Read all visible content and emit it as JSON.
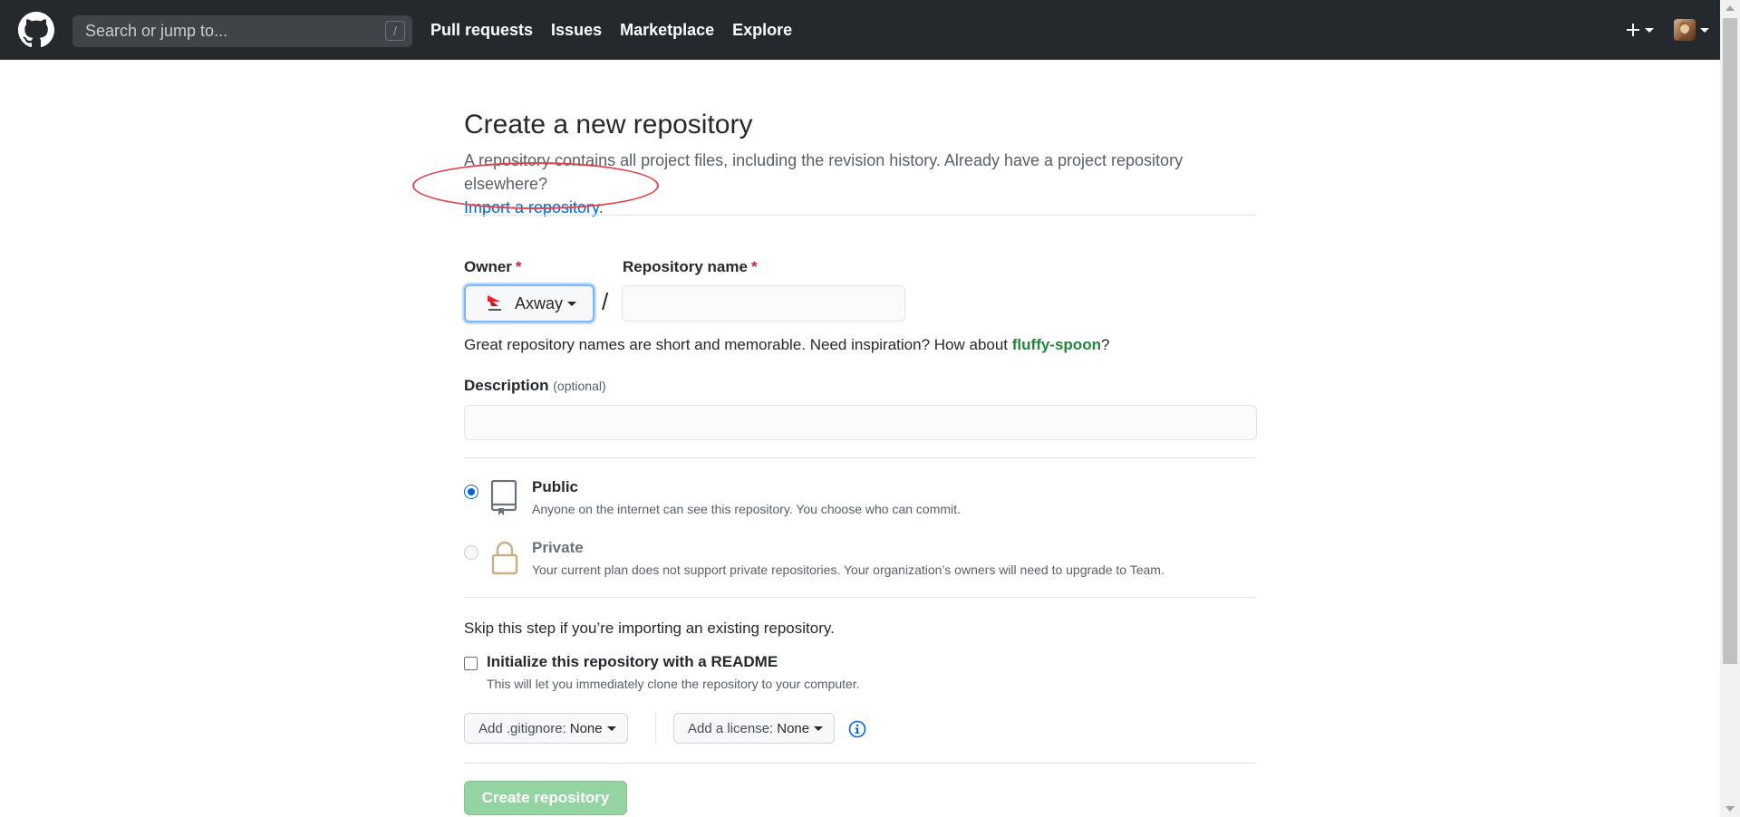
{
  "header": {
    "search_placeholder": "Search or jump to...",
    "search_shortcut": "/",
    "nav": [
      {
        "label": "Pull requests"
      },
      {
        "label": "Issues"
      },
      {
        "label": "Marketplace"
      },
      {
        "label": "Explore"
      }
    ],
    "plus_label": "+"
  },
  "page": {
    "title": "Create a new repository",
    "subtitle": "A repository contains all project files, including the revision history. Already have a project repository elsewhere?",
    "import_link": "Import a repository."
  },
  "form": {
    "owner_label": "Owner",
    "required_mark": "*",
    "owner_value": "Axway",
    "slash": "/",
    "repo_name_label": "Repository name",
    "repo_name_value": "",
    "name_hint_prefix": "Great repository names are short and memorable. Need inspiration? How about",
    "name_suggestion": "fluffy-spoon",
    "name_hint_suffix": "?",
    "description_label": "Description",
    "description_optional": "(optional)",
    "description_value": "",
    "visibility": {
      "public": {
        "title": "Public",
        "description": "Anyone on the internet can see this repository. You choose who can commit.",
        "selected": true
      },
      "private": {
        "title": "Private",
        "description": "Your current plan does not support private repositories. Your organization’s owners will need to upgrade to Team.",
        "disabled": true
      }
    },
    "skip_text": "Skip this step if you’re importing an existing repository.",
    "readme_label": "Initialize this repository with a README",
    "readme_desc": "This will let you immediately clone the repository to your computer.",
    "readme_checked": false,
    "gitignore_label": "Add .gitignore:",
    "gitignore_value": "None",
    "license_label": "Add a license:",
    "license_value": "None",
    "submit_label": "Create repository"
  },
  "colors": {
    "header_bg": "#24292e",
    "link": "#0366d6",
    "required": "#cb2431",
    "suggestion": "#22863a",
    "submit_disabled": "#94d3a2",
    "annotation": "#e0474c"
  }
}
